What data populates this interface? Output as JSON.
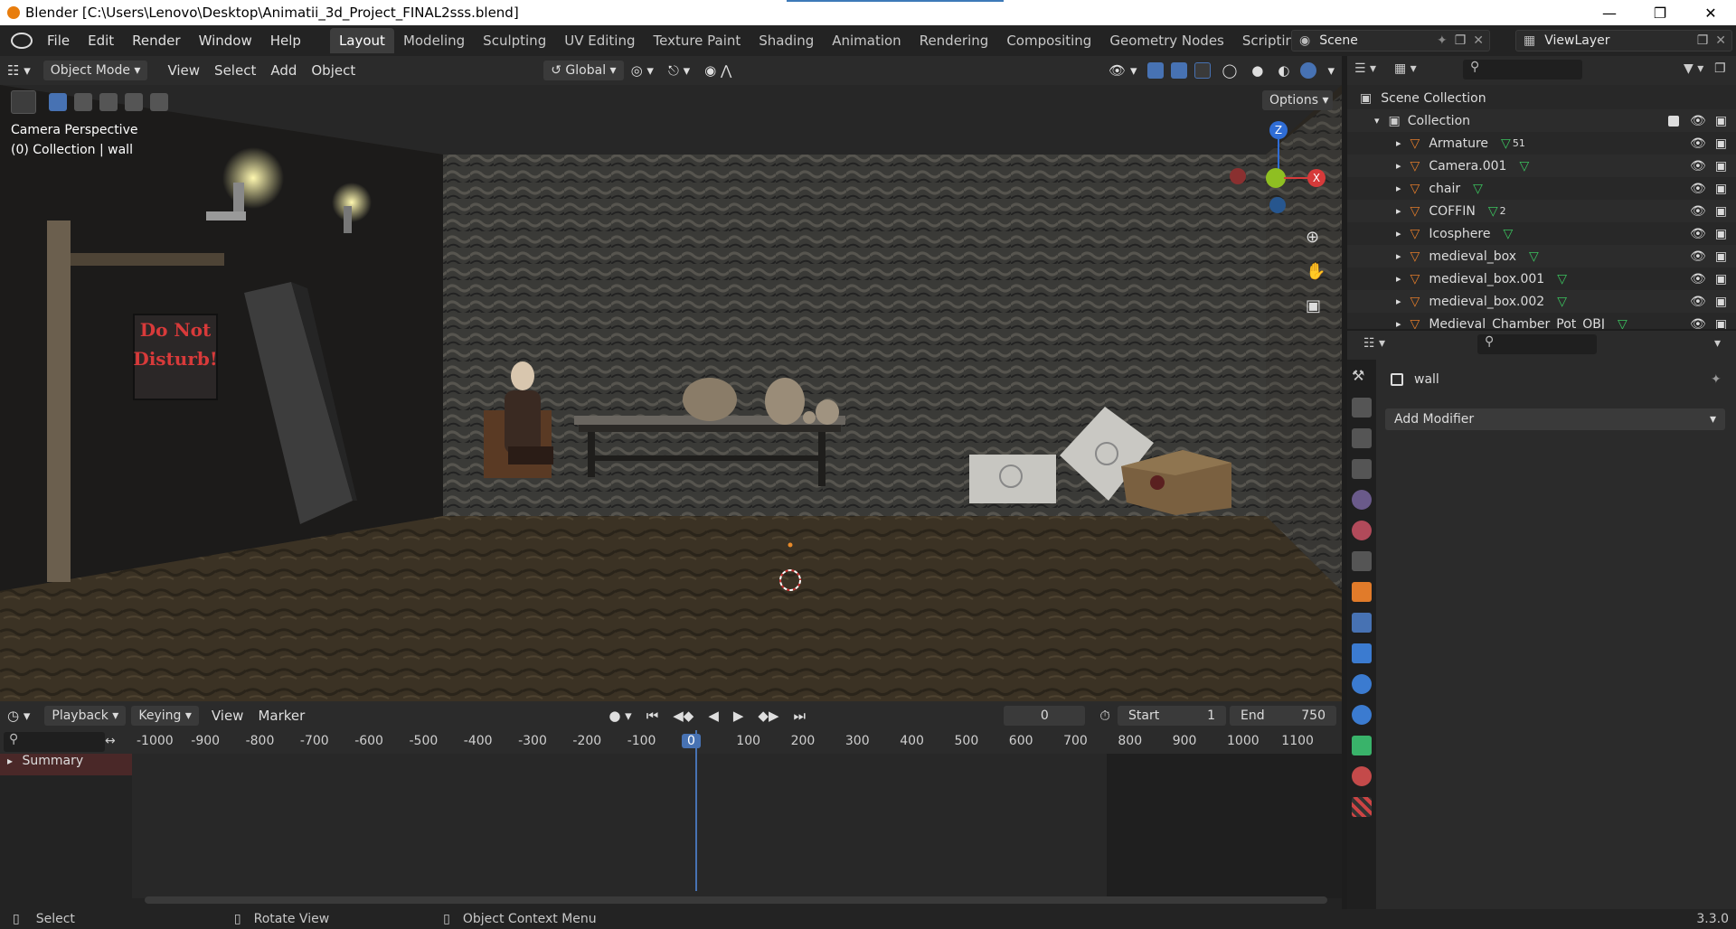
{
  "window": {
    "title": "Blender [C:\\Users\\Lenovo\\Desktop\\Animatii_3d_Project_FINAL2sss.blend]"
  },
  "menu": [
    "File",
    "Edit",
    "Render",
    "Window",
    "Help"
  ],
  "workspaces": [
    "Layout",
    "Modeling",
    "Sculpting",
    "UV Editing",
    "Texture Paint",
    "Shading",
    "Animation",
    "Rendering",
    "Compositing",
    "Geometry Nodes",
    "Scripting"
  ],
  "active_workspace": "Layout",
  "scene": {
    "label": "Scene",
    "view_layer": "ViewLayer"
  },
  "viewport": {
    "mode": "Object Mode",
    "menus": [
      "View",
      "Select",
      "Add",
      "Object"
    ],
    "orientation": "Global",
    "options": "Options",
    "overlay_title": "Camera Perspective",
    "overlay_subtitle": "(0) Collection | wall",
    "sign_text": "Do Not Disturb!",
    "gizmo": {
      "z": "Z",
      "x": "X"
    }
  },
  "timeline": {
    "menus": [
      "Playback",
      "Keying",
      "View",
      "Marker"
    ],
    "current_frame": "0",
    "start_label": "Start",
    "start": "1",
    "end_label": "End",
    "end": "750",
    "ruler": [
      "-1000",
      "-900",
      "-800",
      "-700",
      "-600",
      "-500",
      "-400",
      "-300",
      "-200",
      "-100",
      "0",
      "100",
      "200",
      "300",
      "400",
      "500",
      "600",
      "700",
      "800",
      "900",
      "1000",
      "1100"
    ],
    "summary": "Summary"
  },
  "outliner": {
    "root": "Scene Collection",
    "collection": "Collection",
    "items": [
      {
        "name": "Armature",
        "badge": "51"
      },
      {
        "name": "Camera.001",
        "badge": ""
      },
      {
        "name": "chair",
        "badge": ""
      },
      {
        "name": "COFFIN",
        "badge": "2"
      },
      {
        "name": "Icosphere",
        "badge": ""
      },
      {
        "name": "medieval_box",
        "badge": ""
      },
      {
        "name": "medieval_box.001",
        "badge": ""
      },
      {
        "name": "medieval_box.002",
        "badge": ""
      },
      {
        "name": "Medieval_Chamber_Pot_OBJ",
        "badge": ""
      }
    ]
  },
  "properties": {
    "object_name": "wall",
    "add_modifier": "Add Modifier"
  },
  "status": {
    "select": "Select",
    "rotate": "Rotate View",
    "context": "Object Context Menu",
    "version": "3.3.0"
  }
}
